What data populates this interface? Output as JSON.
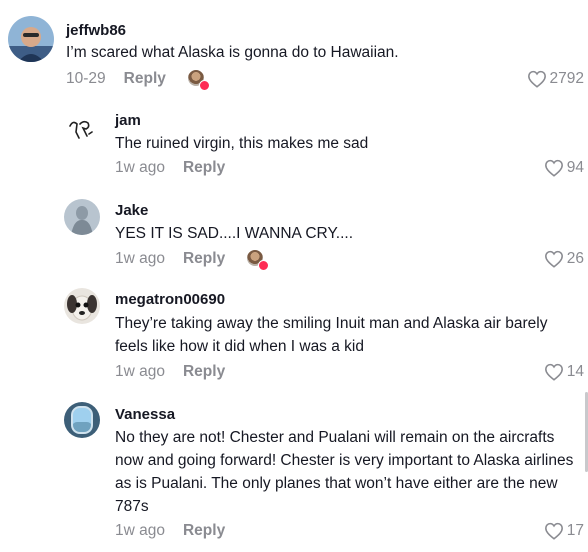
{
  "comments": [
    {
      "username": "jeffwb86",
      "text": "I’m scared what Alaska is gonna do to Hawaiian.",
      "date": "10-29",
      "reply_label": "Reply",
      "likes": "2792",
      "creator_liked": true,
      "avatar_icon": "user-avatar-icon"
    },
    {
      "username": "jam",
      "text": "The ruined virgin, this makes me sad",
      "date": "1w ago",
      "reply_label": "Reply",
      "likes": "94",
      "creator_liked": false,
      "avatar_icon": "sketch-avatar-icon"
    },
    {
      "username": "Jake",
      "text": "YES IT IS SAD....I WANNA CRY....",
      "date": "1w ago",
      "reply_label": "Reply",
      "likes": "26",
      "creator_liked": true,
      "avatar_icon": "statue-avatar-icon"
    },
    {
      "username": "megatron00690",
      "text": "They’re taking away the smiling Inuit man and Alaska air barely feels like how it did when I was a kid",
      "date": "1w ago",
      "reply_label": "Reply",
      "likes": "14",
      "creator_liked": false,
      "avatar_icon": "dog-avatar-icon"
    },
    {
      "username": "Vanessa",
      "text": "No they are not! Chester and Pualani will remain on the aircrafts now and going forward! Chester is very important to Alaska airlines as is Pualani. The only planes that won’t have either are the new 787s",
      "date": "1w ago",
      "reply_label": "Reply",
      "likes": "17",
      "creator_liked": false,
      "avatar_icon": "window-avatar-icon"
    }
  ],
  "colors": {
    "text": "#161823",
    "muted": "#8a8b91",
    "accent": "#fe2c55"
  }
}
